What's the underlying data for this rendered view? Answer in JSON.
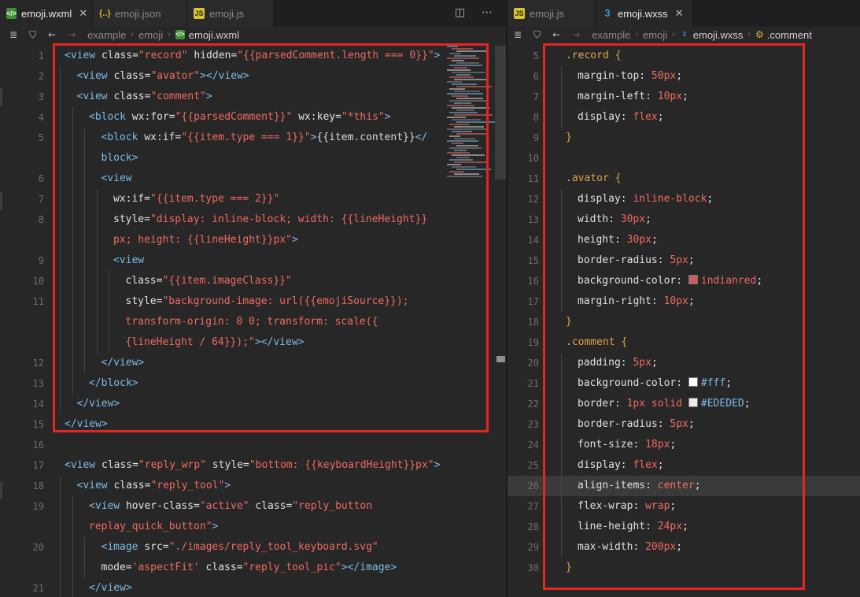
{
  "left": {
    "tabs": [
      {
        "label": "emoji.wxml",
        "kind": "wxml",
        "active": true,
        "closable": true
      },
      {
        "label": "emoji.json",
        "kind": "json",
        "active": false,
        "closable": false
      },
      {
        "label": "emoji.js",
        "kind": "js",
        "active": false,
        "closable": false
      }
    ],
    "breadcrumb": [
      "example",
      "emoji",
      "emoji.wxml"
    ],
    "lines": [
      {
        "n": "1",
        "i": 0,
        "segs": [
          [
            "t",
            "<view "
          ],
          [
            "a",
            "class="
          ],
          [
            "s",
            "\"record\""
          ],
          [
            "a",
            " hidden="
          ],
          [
            "s",
            "\"{{parsedComment.length === 0}}\""
          ],
          [
            "t",
            ">"
          ]
        ]
      },
      {
        "n": "2",
        "i": 1,
        "segs": [
          [
            "t",
            "<view "
          ],
          [
            "a",
            "class="
          ],
          [
            "s",
            "\"avator\""
          ],
          [
            "t",
            "></view>"
          ]
        ]
      },
      {
        "n": "3",
        "i": 1,
        "segs": [
          [
            "t",
            "<view "
          ],
          [
            "a",
            "class="
          ],
          [
            "s",
            "\"comment\""
          ],
          [
            "t",
            ">"
          ]
        ]
      },
      {
        "n": "4",
        "i": 2,
        "segs": [
          [
            "t",
            "<block "
          ],
          [
            "a",
            "wx:for="
          ],
          [
            "s",
            "\"{{parsedComment}}\""
          ],
          [
            "a",
            " wx:key="
          ],
          [
            "s",
            "\"*this\""
          ],
          [
            "t",
            ">"
          ]
        ]
      },
      {
        "n": "5",
        "i": 3,
        "segs": [
          [
            "t",
            "<block "
          ],
          [
            "a",
            "wx:if="
          ],
          [
            "s",
            "\"{{item.type === 1}}\""
          ],
          [
            "t",
            ">"
          ],
          [
            "p",
            "{{item.content}}"
          ],
          [
            "t",
            "</"
          ]
        ]
      },
      {
        "n": "",
        "i": 3,
        "segs": [
          [
            "t",
            "block>"
          ]
        ]
      },
      {
        "n": "6",
        "i": 3,
        "segs": [
          [
            "t",
            "<view"
          ]
        ]
      },
      {
        "n": "7",
        "i": 4,
        "segs": [
          [
            "a",
            "wx:if="
          ],
          [
            "s",
            "\"{{item.type === 2}}\""
          ]
        ]
      },
      {
        "n": "8",
        "i": 4,
        "segs": [
          [
            "a",
            "style="
          ],
          [
            "s",
            "\"display: inline-block; width: {{lineHeight}}"
          ]
        ]
      },
      {
        "n": "",
        "i": 4,
        "segs": [
          [
            "s",
            "px; height: {{lineHeight}}px\""
          ],
          [
            "t",
            ">"
          ]
        ]
      },
      {
        "n": "9",
        "i": 4,
        "segs": [
          [
            "t",
            "<view"
          ]
        ]
      },
      {
        "n": "10",
        "i": 5,
        "segs": [
          [
            "a",
            "class="
          ],
          [
            "s",
            "\"{{item.imageClass}}\""
          ]
        ]
      },
      {
        "n": "11",
        "i": 5,
        "segs": [
          [
            "a",
            "style="
          ],
          [
            "s",
            "\"background-image: url({{emojiSource}});"
          ]
        ]
      },
      {
        "n": "",
        "i": 5,
        "segs": [
          [
            "s",
            "transform-origin: 0 0; transform: scale({"
          ]
        ]
      },
      {
        "n": "",
        "i": 5,
        "segs": [
          [
            "s",
            "{lineHeight / 64}});\""
          ],
          [
            "t",
            "></view>"
          ]
        ]
      },
      {
        "n": "12",
        "i": 3,
        "segs": [
          [
            "t",
            "</view>"
          ]
        ]
      },
      {
        "n": "13",
        "i": 2,
        "segs": [
          [
            "t",
            "</block>"
          ]
        ]
      },
      {
        "n": "14",
        "i": 1,
        "segs": [
          [
            "t",
            "</view>"
          ]
        ]
      },
      {
        "n": "15",
        "i": 0,
        "segs": [
          [
            "t",
            "</view>"
          ]
        ]
      },
      {
        "n": "16",
        "i": 0,
        "segs": []
      },
      {
        "n": "17",
        "i": 0,
        "segs": [
          [
            "t",
            "<view "
          ],
          [
            "a",
            "class="
          ],
          [
            "s",
            "\"reply_wrp\""
          ],
          [
            "a",
            " style="
          ],
          [
            "s",
            "\"bottom: {{keyboardHeight}}px\""
          ],
          [
            "t",
            ">"
          ]
        ]
      },
      {
        "n": "18",
        "i": 1,
        "segs": [
          [
            "t",
            "<view "
          ],
          [
            "a",
            "class="
          ],
          [
            "s",
            "\"reply_tool\""
          ],
          [
            "t",
            ">"
          ]
        ]
      },
      {
        "n": "19",
        "i": 2,
        "segs": [
          [
            "t",
            "<view "
          ],
          [
            "a",
            "hover-class="
          ],
          [
            "s",
            "\"active\""
          ],
          [
            "a",
            " class="
          ],
          [
            "s",
            "\"reply_button"
          ]
        ]
      },
      {
        "n": "",
        "i": 2,
        "segs": [
          [
            "s",
            "replay_quick_button\""
          ],
          [
            "t",
            ">"
          ]
        ]
      },
      {
        "n": "20",
        "i": 3,
        "segs": [
          [
            "t",
            "<image "
          ],
          [
            "a",
            "src="
          ],
          [
            "s",
            "\"./images/reply_tool_keyboard.svg\""
          ]
        ]
      },
      {
        "n": "",
        "i": 3,
        "segs": [
          [
            "a",
            "mode="
          ],
          [
            "s",
            "'aspectFit'"
          ],
          [
            "a",
            " class="
          ],
          [
            "s",
            "\"reply_tool_pic\""
          ],
          [
            "t",
            "></image>"
          ]
        ]
      },
      {
        "n": "21",
        "i": 2,
        "segs": [
          [
            "t",
            "</view>"
          ]
        ]
      }
    ]
  },
  "right": {
    "tabs": [
      {
        "label": "emoji.js",
        "kind": "js",
        "active": false,
        "closable": false
      },
      {
        "label": "emoji.wxss",
        "kind": "wxss",
        "active": true,
        "closable": true
      }
    ],
    "breadcrumb": [
      "example",
      "emoji",
      "emoji.wxss",
      ".comment"
    ],
    "lines": [
      {
        "n": "5",
        "i": 0,
        "segs": [
          [
            "sel",
            ".record "
          ],
          [
            "sel",
            "{"
          ]
        ]
      },
      {
        "n": "6",
        "i": 1,
        "segs": [
          [
            "prop",
            "margin-top: "
          ],
          [
            "v",
            "50px"
          ],
          [
            "prop",
            ";"
          ]
        ]
      },
      {
        "n": "7",
        "i": 1,
        "segs": [
          [
            "prop",
            "margin-left: "
          ],
          [
            "v",
            "10px"
          ],
          [
            "prop",
            ";"
          ]
        ]
      },
      {
        "n": "8",
        "i": 1,
        "segs": [
          [
            "prop",
            "display: "
          ],
          [
            "v",
            "flex"
          ],
          [
            "prop",
            ";"
          ]
        ]
      },
      {
        "n": "9",
        "i": 0,
        "segs": [
          [
            "sel",
            "}"
          ]
        ]
      },
      {
        "n": "10",
        "i": 0,
        "segs": []
      },
      {
        "n": "11",
        "i": 0,
        "segs": [
          [
            "sel",
            ".avator "
          ],
          [
            "sel",
            "{"
          ]
        ]
      },
      {
        "n": "12",
        "i": 1,
        "segs": [
          [
            "prop",
            "display: "
          ],
          [
            "v",
            "inline-block"
          ],
          [
            "prop",
            ";"
          ]
        ]
      },
      {
        "n": "13",
        "i": 1,
        "segs": [
          [
            "prop",
            "width: "
          ],
          [
            "v",
            "30px"
          ],
          [
            "prop",
            ";"
          ]
        ]
      },
      {
        "n": "14",
        "i": 1,
        "segs": [
          [
            "prop",
            "height: "
          ],
          [
            "v",
            "30px"
          ],
          [
            "prop",
            ";"
          ]
        ]
      },
      {
        "n": "15",
        "i": 1,
        "segs": [
          [
            "prop",
            "border-radius: "
          ],
          [
            "v",
            "5px"
          ],
          [
            "prop",
            ";"
          ]
        ]
      },
      {
        "n": "16",
        "i": 1,
        "swatch": "#cd5c5c",
        "segs": [
          [
            "prop",
            "background-color: "
          ],
          [
            "sw",
            ""
          ],
          [
            "v",
            "indianred"
          ],
          [
            "prop",
            ";"
          ]
        ]
      },
      {
        "n": "17",
        "i": 1,
        "segs": [
          [
            "prop",
            "margin-right: "
          ],
          [
            "v",
            "10px"
          ],
          [
            "prop",
            ";"
          ]
        ]
      },
      {
        "n": "18",
        "i": 0,
        "segs": [
          [
            "sel",
            "}"
          ]
        ]
      },
      {
        "n": "19",
        "i": 0,
        "segs": [
          [
            "sel",
            ".comment "
          ],
          [
            "sel",
            "{"
          ]
        ]
      },
      {
        "n": "20",
        "i": 1,
        "segs": [
          [
            "prop",
            "padding: "
          ],
          [
            "v",
            "5px"
          ],
          [
            "prop",
            ";"
          ]
        ]
      },
      {
        "n": "21",
        "i": 1,
        "swatch": "#ffffff",
        "segs": [
          [
            "prop",
            "background-color: "
          ],
          [
            "sw",
            ""
          ],
          [
            "t",
            "#fff"
          ],
          [
            "prop",
            ";"
          ]
        ]
      },
      {
        "n": "22",
        "i": 1,
        "swatch": "#ededed",
        "segs": [
          [
            "prop",
            "border: "
          ],
          [
            "v",
            "1px solid "
          ],
          [
            "sw",
            ""
          ],
          [
            "t",
            "#EDEDED"
          ],
          [
            "prop",
            ";"
          ]
        ]
      },
      {
        "n": "23",
        "i": 1,
        "segs": [
          [
            "prop",
            "border-radius: "
          ],
          [
            "v",
            "5px"
          ],
          [
            "prop",
            ";"
          ]
        ]
      },
      {
        "n": "24",
        "i": 1,
        "segs": [
          [
            "prop",
            "font-size: "
          ],
          [
            "v",
            "18px"
          ],
          [
            "prop",
            ";"
          ]
        ]
      },
      {
        "n": "25",
        "i": 1,
        "segs": [
          [
            "prop",
            "display: "
          ],
          [
            "v",
            "flex"
          ],
          [
            "prop",
            ";"
          ]
        ]
      },
      {
        "n": "26",
        "i": 1,
        "hl": true,
        "segs": [
          [
            "prop",
            "align-items: "
          ],
          [
            "v",
            "center"
          ],
          [
            "prop",
            ";"
          ]
        ]
      },
      {
        "n": "27",
        "i": 1,
        "segs": [
          [
            "prop",
            "flex-wrap: "
          ],
          [
            "v",
            "wrap"
          ],
          [
            "prop",
            ";"
          ]
        ]
      },
      {
        "n": "28",
        "i": 1,
        "segs": [
          [
            "prop",
            "line-height: "
          ],
          [
            "v",
            "24px"
          ],
          [
            "prop",
            ";"
          ]
        ]
      },
      {
        "n": "29",
        "i": 1,
        "segs": [
          [
            "prop",
            "max-width: "
          ],
          [
            "v",
            "200px"
          ],
          [
            "prop",
            ";"
          ]
        ]
      },
      {
        "n": "30",
        "i": 0,
        "segs": [
          [
            "sel",
            "}"
          ]
        ]
      }
    ]
  },
  "colors": {
    "highlight_box": "#e52424",
    "tag": "#7dbbe6",
    "string": "#f06a62",
    "selector": "#e3a34c"
  },
  "icons": {
    "split": "split-editor-icon",
    "more": "more-icon",
    "list": "list-icon",
    "bookmark": "bookmark-icon",
    "back": "back-arrow-icon",
    "forward": "forward-arrow-icon"
  }
}
